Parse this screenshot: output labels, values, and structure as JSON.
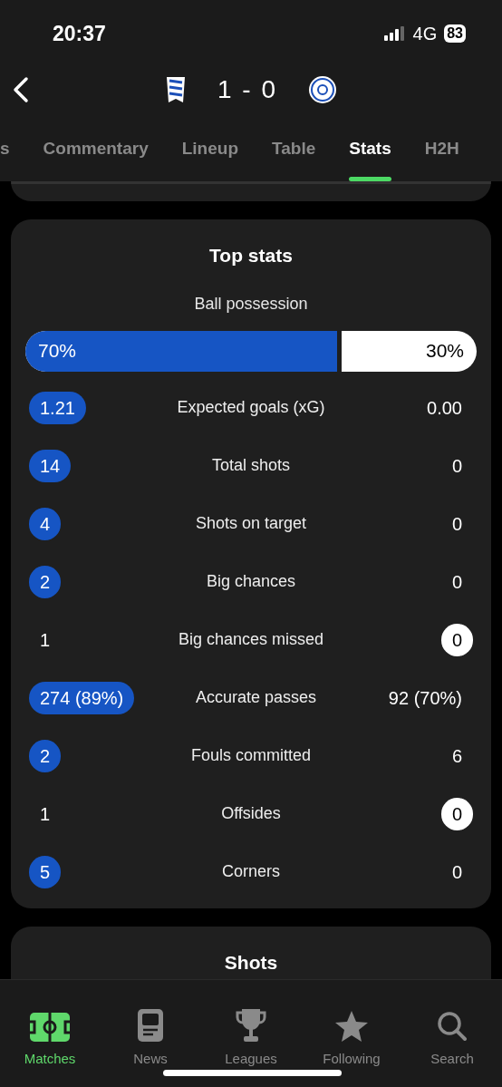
{
  "status_bar": {
    "time": "20:37",
    "network": "4G",
    "battery": "83"
  },
  "header": {
    "score": "1 - 0"
  },
  "tabs": [
    {
      "label": "s",
      "selected": false
    },
    {
      "label": "Commentary",
      "selected": false
    },
    {
      "label": "Lineup",
      "selected": false
    },
    {
      "label": "Table",
      "selected": false
    },
    {
      "label": "Stats",
      "selected": true
    },
    {
      "label": "H2H",
      "selected": false
    }
  ],
  "top_stats": {
    "title": "Top stats",
    "possession": {
      "label": "Ball possession",
      "home": "70%",
      "away": "30%",
      "level": 0.7
    },
    "rows": [
      {
        "home": "1.21",
        "label": "Expected goals (xG)",
        "away": "0.00",
        "home_highlighted": true,
        "away_highlighted": false
      },
      {
        "home": "14",
        "label": "Total shots",
        "away": "0",
        "home_highlighted": true,
        "away_highlighted": false
      },
      {
        "home": "4",
        "label": "Shots on target",
        "away": "0",
        "home_highlighted": true,
        "away_highlighted": false
      },
      {
        "home": "2",
        "label": "Big chances",
        "away": "0",
        "home_highlighted": true,
        "away_highlighted": false
      },
      {
        "home": "1",
        "label": "Big chances missed",
        "away": "0",
        "home_highlighted": false,
        "away_highlighted": true
      },
      {
        "home": "274 (89%)",
        "label": "Accurate passes",
        "away": "92 (70%)",
        "home_highlighted": true,
        "away_highlighted": false
      },
      {
        "home": "2",
        "label": "Fouls committed",
        "away": "6",
        "home_highlighted": true,
        "away_highlighted": false
      },
      {
        "home": "1",
        "label": "Offsides",
        "away": "0",
        "home_highlighted": false,
        "away_highlighted": true
      },
      {
        "home": "5",
        "label": "Corners",
        "away": "0",
        "home_highlighted": true,
        "away_highlighted": false
      }
    ]
  },
  "next_card": {
    "title": "Shots"
  },
  "nav": [
    {
      "label": "Matches",
      "kind": "pitch",
      "selected": true
    },
    {
      "label": "News",
      "kind": "news",
      "selected": false
    },
    {
      "label": "Leagues",
      "kind": "trophy",
      "selected": false
    },
    {
      "label": "Following",
      "kind": "star",
      "selected": false
    },
    {
      "label": "Search",
      "kind": "search",
      "selected": false
    }
  ]
}
